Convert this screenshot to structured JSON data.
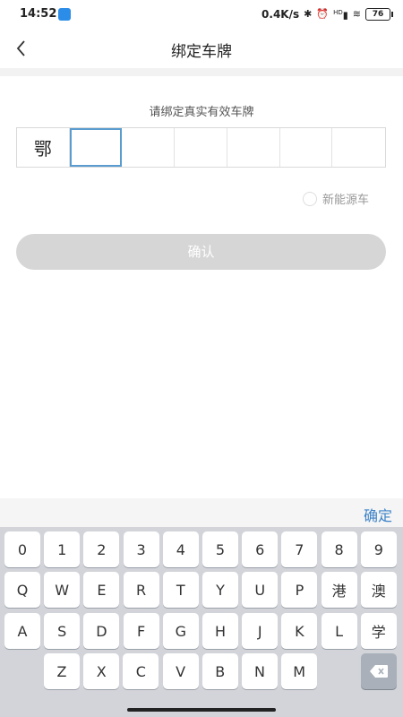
{
  "status_bar": {
    "time": "14:52",
    "net_speed": "0.4K/s",
    "battery": "76",
    "net_badge": "HD"
  },
  "header": {
    "title": "绑定车牌"
  },
  "form": {
    "prompt": "请绑定真实有效车牌",
    "province": "鄂",
    "plate_slots": [
      "",
      "",
      "",
      "",
      "",
      ""
    ],
    "new_energy_label": "新能源车",
    "confirm_label": "确认"
  },
  "keyboard": {
    "done_label": "确定",
    "rows": [
      [
        "0",
        "1",
        "2",
        "3",
        "4",
        "5",
        "6",
        "7",
        "8",
        "9"
      ],
      [
        "Q",
        "W",
        "E",
        "R",
        "T",
        "Y",
        "U",
        "P",
        "港",
        "澳"
      ],
      [
        "A",
        "S",
        "D",
        "F",
        "G",
        "H",
        "J",
        "K",
        "L",
        "学"
      ],
      [
        "Z",
        "X",
        "C",
        "V",
        "B",
        "N",
        "M"
      ]
    ]
  }
}
